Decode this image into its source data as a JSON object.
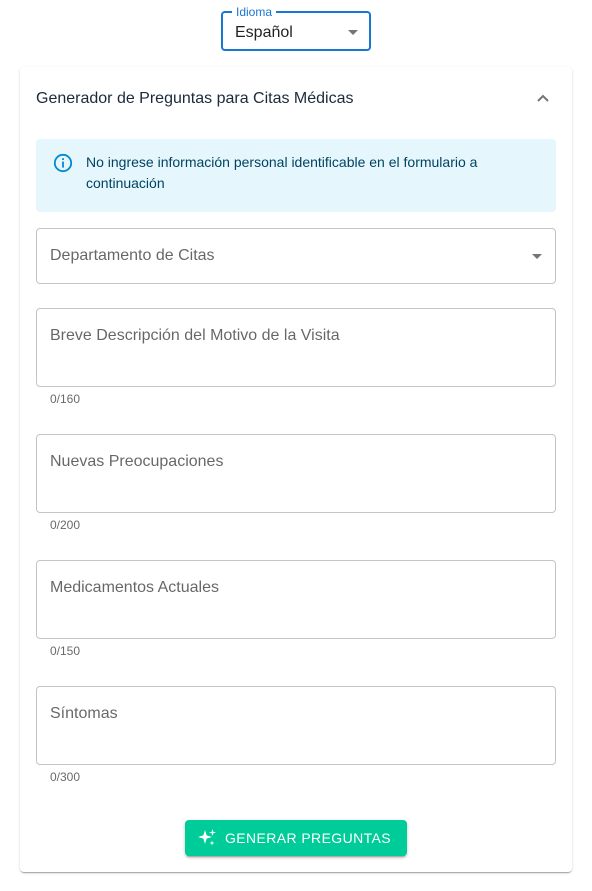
{
  "language_select": {
    "label": "Idioma",
    "value": "Español"
  },
  "card": {
    "title": "Generador de Preguntas para Citas Médicas",
    "alert": "No ingrese información personal identificable en el formulario a continuación",
    "department_select": {
      "placeholder": "Departamento de Citas"
    },
    "fields": [
      {
        "label": "Breve Descripción del Motivo de la Visita",
        "counter": "0/160"
      },
      {
        "label": "Nuevas Preocupaciones",
        "counter": "0/200"
      },
      {
        "label": "Medicamentos Actuales",
        "counter": "0/150"
      },
      {
        "label": "Síntomas",
        "counter": "0/300"
      }
    ],
    "generate_button": "Generar Preguntas"
  },
  "colors": {
    "primary": "#1976d2",
    "button": "#00cc99",
    "alert_bg": "#e5f6fd",
    "alert_text": "#014361"
  },
  "icons": {
    "collapse": "chevron-up-icon",
    "alert": "info-icon",
    "button": "sparkle-icon",
    "dropdown": "caret-down-icon"
  }
}
